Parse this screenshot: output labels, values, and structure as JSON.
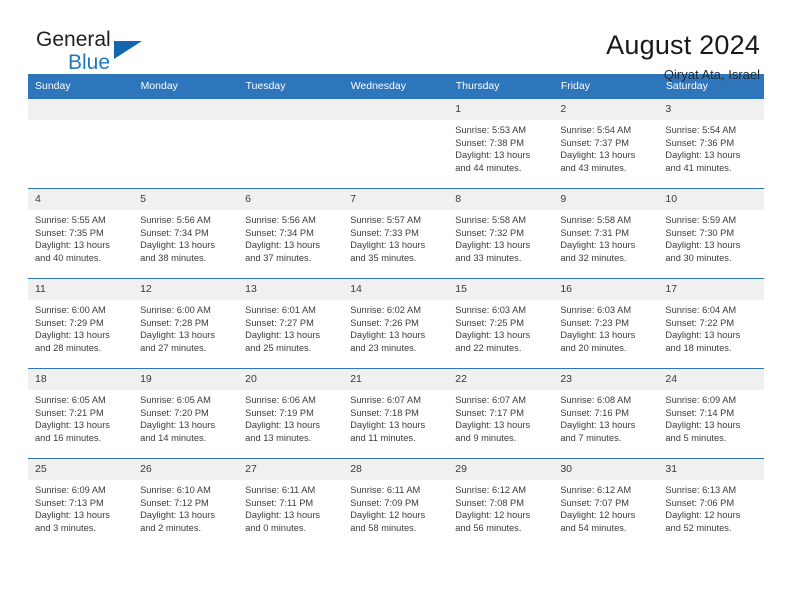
{
  "brand": {
    "name_part1": "General",
    "name_part2": "Blue",
    "triangle_color": "#1266ae",
    "blue": "#1f78c1"
  },
  "header": {
    "title": "August 2024",
    "subtitle": "Qiryat Ata, Israel"
  },
  "theme": {
    "header_bg": "#2e76bc",
    "daynum_bg": "#f0f0f0",
    "text": "#3c3c3c"
  },
  "weekdays": [
    "Sunday",
    "Monday",
    "Tuesday",
    "Wednesday",
    "Thursday",
    "Friday",
    "Saturday"
  ],
  "weeks": [
    [
      {
        "day": "",
        "empty": true
      },
      {
        "day": "",
        "empty": true
      },
      {
        "day": "",
        "empty": true
      },
      {
        "day": "",
        "empty": true
      },
      {
        "day": "1",
        "sunrise": "Sunrise: 5:53 AM",
        "sunset": "Sunset: 7:38 PM",
        "daylight1": "Daylight: 13 hours",
        "daylight2": "and 44 minutes."
      },
      {
        "day": "2",
        "sunrise": "Sunrise: 5:54 AM",
        "sunset": "Sunset: 7:37 PM",
        "daylight1": "Daylight: 13 hours",
        "daylight2": "and 43 minutes."
      },
      {
        "day": "3",
        "sunrise": "Sunrise: 5:54 AM",
        "sunset": "Sunset: 7:36 PM",
        "daylight1": "Daylight: 13 hours",
        "daylight2": "and 41 minutes."
      }
    ],
    [
      {
        "day": "4",
        "sunrise": "Sunrise: 5:55 AM",
        "sunset": "Sunset: 7:35 PM",
        "daylight1": "Daylight: 13 hours",
        "daylight2": "and 40 minutes."
      },
      {
        "day": "5",
        "sunrise": "Sunrise: 5:56 AM",
        "sunset": "Sunset: 7:34 PM",
        "daylight1": "Daylight: 13 hours",
        "daylight2": "and 38 minutes."
      },
      {
        "day": "6",
        "sunrise": "Sunrise: 5:56 AM",
        "sunset": "Sunset: 7:34 PM",
        "daylight1": "Daylight: 13 hours",
        "daylight2": "and 37 minutes."
      },
      {
        "day": "7",
        "sunrise": "Sunrise: 5:57 AM",
        "sunset": "Sunset: 7:33 PM",
        "daylight1": "Daylight: 13 hours",
        "daylight2": "and 35 minutes."
      },
      {
        "day": "8",
        "sunrise": "Sunrise: 5:58 AM",
        "sunset": "Sunset: 7:32 PM",
        "daylight1": "Daylight: 13 hours",
        "daylight2": "and 33 minutes."
      },
      {
        "day": "9",
        "sunrise": "Sunrise: 5:58 AM",
        "sunset": "Sunset: 7:31 PM",
        "daylight1": "Daylight: 13 hours",
        "daylight2": "and 32 minutes."
      },
      {
        "day": "10",
        "sunrise": "Sunrise: 5:59 AM",
        "sunset": "Sunset: 7:30 PM",
        "daylight1": "Daylight: 13 hours",
        "daylight2": "and 30 minutes."
      }
    ],
    [
      {
        "day": "11",
        "sunrise": "Sunrise: 6:00 AM",
        "sunset": "Sunset: 7:29 PM",
        "daylight1": "Daylight: 13 hours",
        "daylight2": "and 28 minutes."
      },
      {
        "day": "12",
        "sunrise": "Sunrise: 6:00 AM",
        "sunset": "Sunset: 7:28 PM",
        "daylight1": "Daylight: 13 hours",
        "daylight2": "and 27 minutes."
      },
      {
        "day": "13",
        "sunrise": "Sunrise: 6:01 AM",
        "sunset": "Sunset: 7:27 PM",
        "daylight1": "Daylight: 13 hours",
        "daylight2": "and 25 minutes."
      },
      {
        "day": "14",
        "sunrise": "Sunrise: 6:02 AM",
        "sunset": "Sunset: 7:26 PM",
        "daylight1": "Daylight: 13 hours",
        "daylight2": "and 23 minutes."
      },
      {
        "day": "15",
        "sunrise": "Sunrise: 6:03 AM",
        "sunset": "Sunset: 7:25 PM",
        "daylight1": "Daylight: 13 hours",
        "daylight2": "and 22 minutes."
      },
      {
        "day": "16",
        "sunrise": "Sunrise: 6:03 AM",
        "sunset": "Sunset: 7:23 PM",
        "daylight1": "Daylight: 13 hours",
        "daylight2": "and 20 minutes."
      },
      {
        "day": "17",
        "sunrise": "Sunrise: 6:04 AM",
        "sunset": "Sunset: 7:22 PM",
        "daylight1": "Daylight: 13 hours",
        "daylight2": "and 18 minutes."
      }
    ],
    [
      {
        "day": "18",
        "sunrise": "Sunrise: 6:05 AM",
        "sunset": "Sunset: 7:21 PM",
        "daylight1": "Daylight: 13 hours",
        "daylight2": "and 16 minutes."
      },
      {
        "day": "19",
        "sunrise": "Sunrise: 6:05 AM",
        "sunset": "Sunset: 7:20 PM",
        "daylight1": "Daylight: 13 hours",
        "daylight2": "and 14 minutes."
      },
      {
        "day": "20",
        "sunrise": "Sunrise: 6:06 AM",
        "sunset": "Sunset: 7:19 PM",
        "daylight1": "Daylight: 13 hours",
        "daylight2": "and 13 minutes."
      },
      {
        "day": "21",
        "sunrise": "Sunrise: 6:07 AM",
        "sunset": "Sunset: 7:18 PM",
        "daylight1": "Daylight: 13 hours",
        "daylight2": "and 11 minutes."
      },
      {
        "day": "22",
        "sunrise": "Sunrise: 6:07 AM",
        "sunset": "Sunset: 7:17 PM",
        "daylight1": "Daylight: 13 hours",
        "daylight2": "and 9 minutes."
      },
      {
        "day": "23",
        "sunrise": "Sunrise: 6:08 AM",
        "sunset": "Sunset: 7:16 PM",
        "daylight1": "Daylight: 13 hours",
        "daylight2": "and 7 minutes."
      },
      {
        "day": "24",
        "sunrise": "Sunrise: 6:09 AM",
        "sunset": "Sunset: 7:14 PM",
        "daylight1": "Daylight: 13 hours",
        "daylight2": "and 5 minutes."
      }
    ],
    [
      {
        "day": "25",
        "sunrise": "Sunrise: 6:09 AM",
        "sunset": "Sunset: 7:13 PM",
        "daylight1": "Daylight: 13 hours",
        "daylight2": "and 3 minutes."
      },
      {
        "day": "26",
        "sunrise": "Sunrise: 6:10 AM",
        "sunset": "Sunset: 7:12 PM",
        "daylight1": "Daylight: 13 hours",
        "daylight2": "and 2 minutes."
      },
      {
        "day": "27",
        "sunrise": "Sunrise: 6:11 AM",
        "sunset": "Sunset: 7:11 PM",
        "daylight1": "Daylight: 13 hours",
        "daylight2": "and 0 minutes."
      },
      {
        "day": "28",
        "sunrise": "Sunrise: 6:11 AM",
        "sunset": "Sunset: 7:09 PM",
        "daylight1": "Daylight: 12 hours",
        "daylight2": "and 58 minutes."
      },
      {
        "day": "29",
        "sunrise": "Sunrise: 6:12 AM",
        "sunset": "Sunset: 7:08 PM",
        "daylight1": "Daylight: 12 hours",
        "daylight2": "and 56 minutes."
      },
      {
        "day": "30",
        "sunrise": "Sunrise: 6:12 AM",
        "sunset": "Sunset: 7:07 PM",
        "daylight1": "Daylight: 12 hours",
        "daylight2": "and 54 minutes."
      },
      {
        "day": "31",
        "sunrise": "Sunrise: 6:13 AM",
        "sunset": "Sunset: 7:06 PM",
        "daylight1": "Daylight: 12 hours",
        "daylight2": "and 52 minutes."
      }
    ]
  ]
}
